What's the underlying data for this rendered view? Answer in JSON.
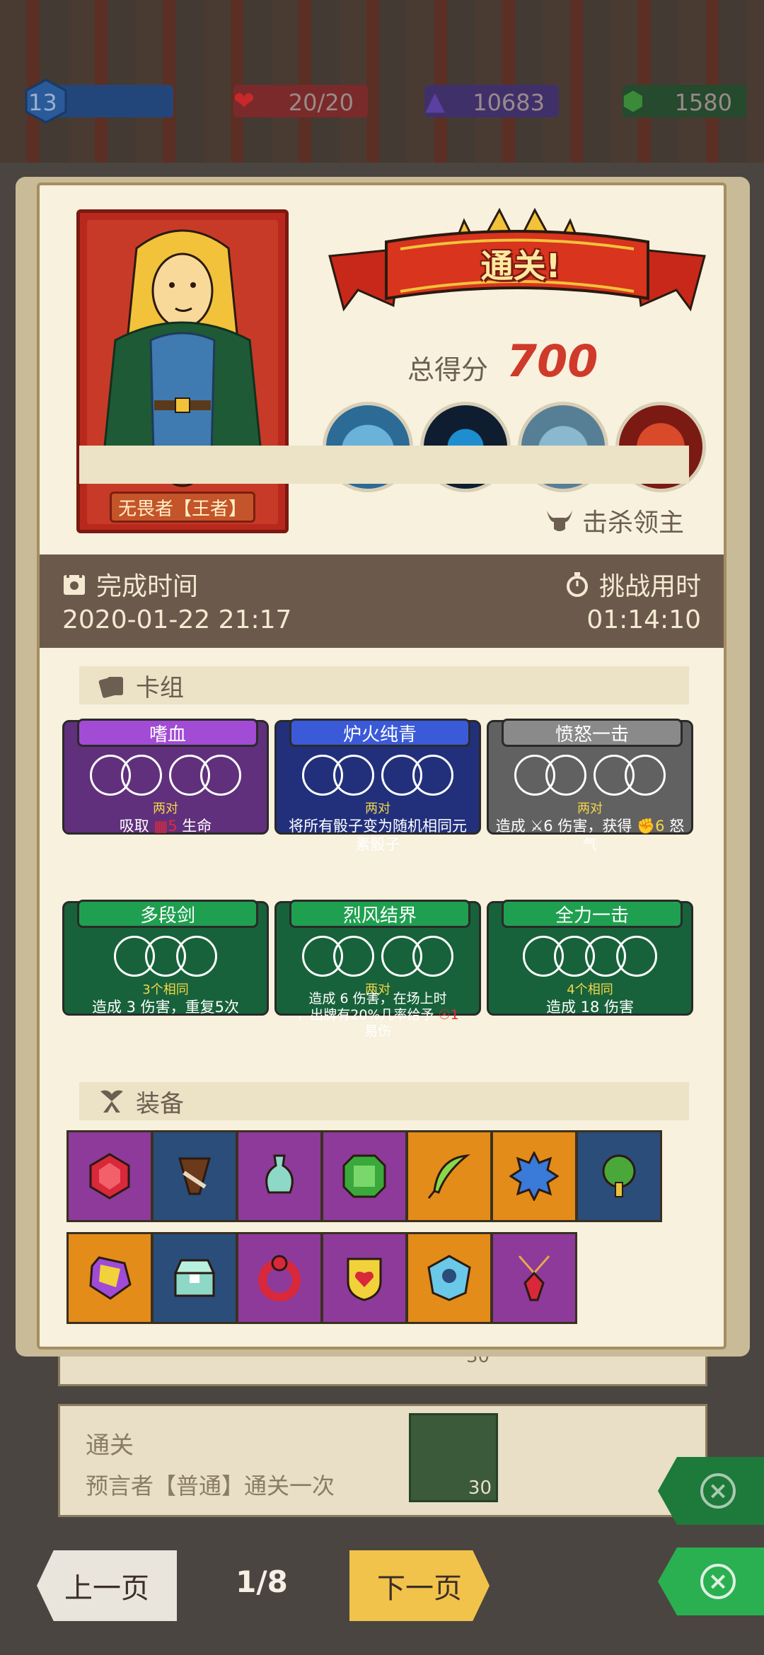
{
  "status": {
    "level": "13",
    "hp": "20/20",
    "gems": "10683",
    "coins": "1580"
  },
  "hero": {
    "name": "无畏者【王者】"
  },
  "result": {
    "banner": "通关!",
    "score_label": "总得分",
    "score": "700",
    "boss_kill_label": "击杀领主"
  },
  "times": {
    "finish_label": "完成时间",
    "finish_value": "2020-01-22 21:17",
    "duration_label": "挑战用时",
    "duration_value": "01:14:10"
  },
  "deck": {
    "title": "卡组",
    "cards": [
      {
        "name": "嗜血",
        "req": "两对",
        "desc_pre": "吸取 ",
        "desc_num": "5",
        "desc_post": " 生命",
        "color": "purple"
      },
      {
        "name": "炉火纯青",
        "req": "两对",
        "desc": "将所有骰子变为随机相同元素骰子",
        "color": "blue"
      },
      {
        "name": "愤怒一击",
        "req": "两对",
        "desc_pre": "造成 ",
        "desc_num": "6",
        "desc_post": " 伤害，获得 ",
        "desc_num2": "6",
        "desc_post2": " 怒气",
        "color": "gray"
      },
      {
        "name": "多段剑",
        "req": "3个相同",
        "desc": "造成 3 伤害，重复5次",
        "color": "green"
      },
      {
        "name": "烈风结界",
        "req": "两对",
        "desc_line1": "造成 6 伤害，在场上时",
        "desc_line2": "，出牌有20%几率给予 ",
        "desc_num": "1",
        "desc_line3": "易伤",
        "color": "green"
      },
      {
        "name": "全力一击",
        "req": "4个相同",
        "desc": "造成 18 伤害",
        "color": "green"
      }
    ]
  },
  "equipment": {
    "title": "装备",
    "items": [
      {
        "icon": "ruby-gem-icon",
        "color": "purple"
      },
      {
        "icon": "horn-icon",
        "color": "blue"
      },
      {
        "icon": "vase-icon",
        "color": "purple"
      },
      {
        "icon": "emerald-gem-icon",
        "color": "purple"
      },
      {
        "icon": "feather-icon",
        "color": "orange"
      },
      {
        "icon": "spiked-shield-icon",
        "color": "orange"
      },
      {
        "icon": "tree-icon",
        "color": "blue"
      },
      {
        "icon": "crystal-icon",
        "color": "orange"
      },
      {
        "icon": "chest-icon",
        "color": "blue"
      },
      {
        "icon": "ring-icon",
        "color": "purple"
      },
      {
        "icon": "heart-shield-icon",
        "color": "purple"
      },
      {
        "icon": "skull-badge-icon",
        "color": "orange"
      },
      {
        "icon": "pendant-icon",
        "color": "purple"
      }
    ]
  },
  "behind": {
    "title": "通关",
    "subtitle": "预言者【普通】通关一次",
    "reward": "30",
    "reward_top": "30"
  },
  "nav": {
    "prev": "上一页",
    "page": "1/8",
    "next": "下一页"
  },
  "colors": {
    "accent_red": "#d03a2a",
    "dice_req": "#f4d64a"
  }
}
